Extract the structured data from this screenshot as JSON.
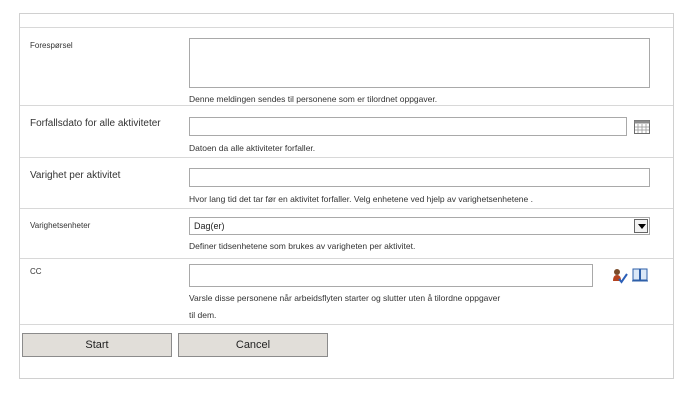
{
  "form": {
    "request": {
      "label": "Forespørsel",
      "value": "",
      "description": "Denne meldingen sendes til personene som er tilordnet oppgaver."
    },
    "due_date": {
      "label": "Forfallsdato for alle aktiviteter",
      "value": "",
      "description": "Datoen da alle aktiviteter forfaller."
    },
    "duration": {
      "label": "Varighet per aktivitet",
      "value": "",
      "description": "Hvor lang tid det tar før en aktivitet forfaller. Velg enhetene ved hjelp av varighetsenhetene ."
    },
    "duration_units": {
      "label": "Varighetsenheter",
      "selected": "Dag(er)",
      "description": "Definer tidsenhetene som brukes av varigheten per aktivitet."
    },
    "cc": {
      "label": "CC",
      "value": "",
      "description_line1": "Varsle disse personene når arbeidsflyten starter og slutter uten å tilordne oppgaver",
      "description_line2": "til dem."
    }
  },
  "buttons": {
    "start": "Start",
    "cancel": "Cancel"
  },
  "icons": {
    "calendar": "calendar-icon",
    "check_names": "check-names-icon",
    "address_book": "address-book-icon"
  }
}
